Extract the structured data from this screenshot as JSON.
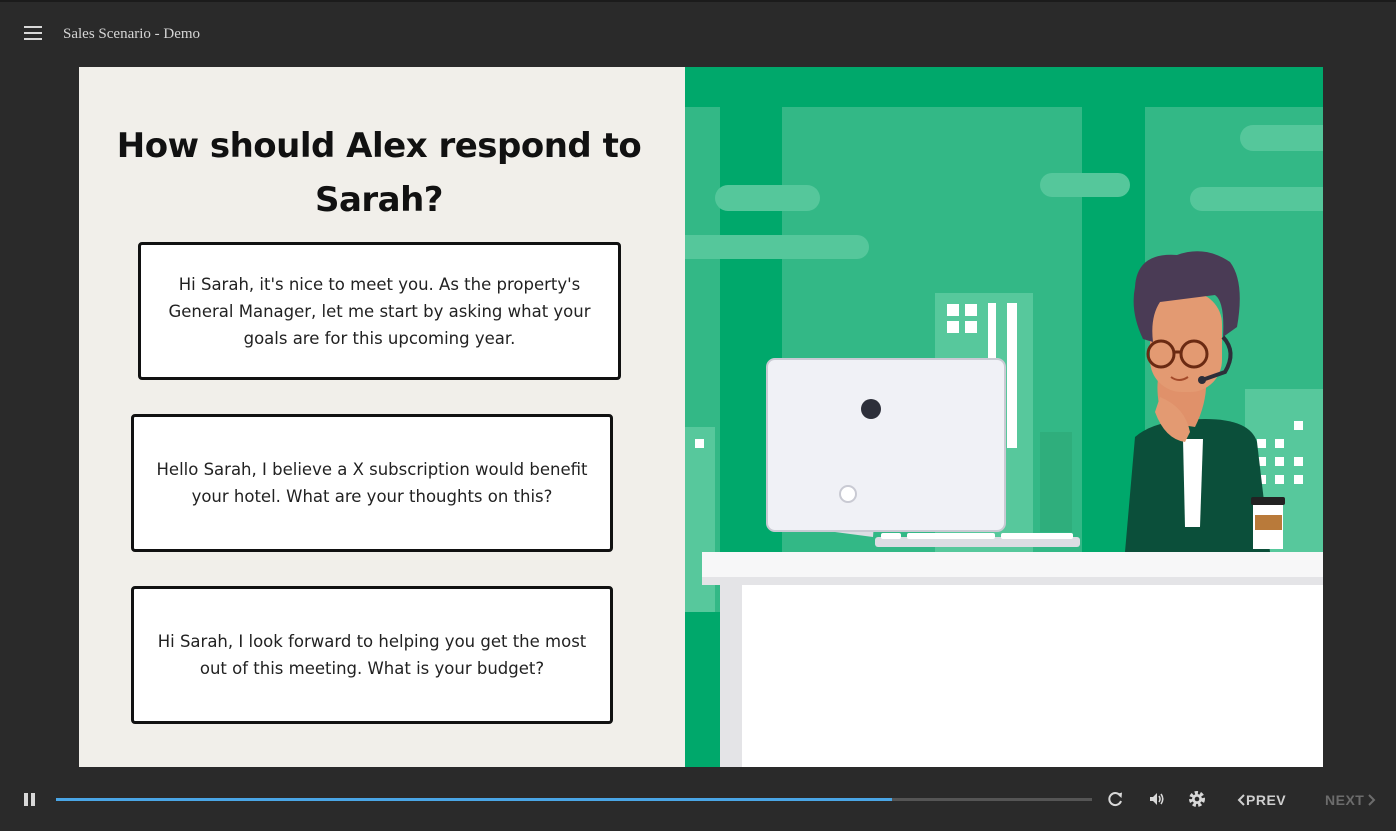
{
  "header": {
    "title": "Sales Scenario - Demo",
    "menu_icon": "hamburger-menu-icon"
  },
  "slide": {
    "question": "How should Alex respond to Sarah?",
    "choices": [
      {
        "text": "Hi Sarah, it's nice to meet you. As the property's General Manager, let me start by asking what your goals are for this upcoming year."
      },
      {
        "text": "Hello Sarah, I believe a X subscription would benefit your hotel. What are your thoughts on this?"
      },
      {
        "text": "Hi Sarah, I look forward to helping you get the most out of this meeting. What is your budget?"
      }
    ],
    "illustration": "office-character-at-desk-illustration",
    "colors": {
      "background": "#f1efea",
      "illustration_green": "#00a86b",
      "choice_border": "#111111"
    }
  },
  "player": {
    "progress_fraction": 0.807,
    "progress_color": "#4aa6e6",
    "prev_label": "PREV",
    "next_label": "NEXT",
    "icons": [
      "pause-icon",
      "replay-icon",
      "volume-icon",
      "settings-icon",
      "chevron-left-icon",
      "chevron-right-icon"
    ]
  }
}
